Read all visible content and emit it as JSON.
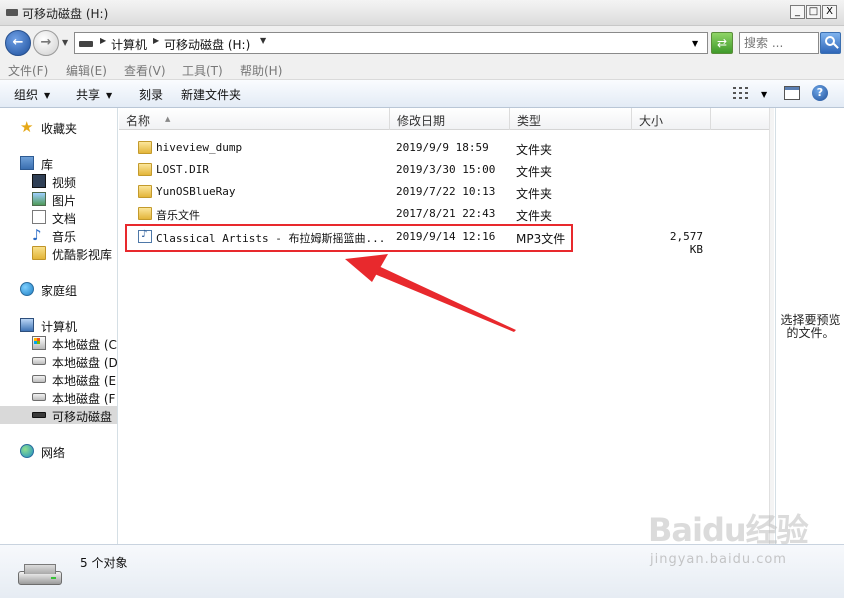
{
  "window": {
    "title": "可移动磁盘 (H:)",
    "minimize": "_",
    "maximize": "□",
    "close": "X"
  },
  "address": {
    "crumbs": [
      "计算机",
      "可移动磁盘 (H:)"
    ],
    "search_placeholder": "搜索 ..."
  },
  "menu": [
    "文件(F)",
    "编辑(E)",
    "查看(V)",
    "工具(T)",
    "帮助(H)"
  ],
  "commands": {
    "organize": "组织",
    "share": "共享",
    "burn": "刻录",
    "new_folder": "新建文件夹"
  },
  "nav": {
    "favorites": "收藏夹",
    "libraries": "库",
    "lib_items": [
      "视频",
      "图片",
      "文档",
      "音乐",
      "优酷影视库"
    ],
    "homegroup": "家庭组",
    "computer": "计算机",
    "drives": [
      "本地磁盘 (C",
      "本地磁盘 (D",
      "本地磁盘 (E",
      "本地磁盘 (F",
      "可移动磁盘"
    ],
    "network": "网络"
  },
  "columns": {
    "name": "名称",
    "date": "修改日期",
    "type": "类型",
    "size": "大小"
  },
  "files": [
    {
      "name": "hiveview_dump",
      "date": "2019/9/9 18:59",
      "type": "文件夹",
      "size": "",
      "icon": "folder-icon"
    },
    {
      "name": "LOST.DIR",
      "date": "2019/3/30 15:00",
      "type": "文件夹",
      "size": "",
      "icon": "folder-icon"
    },
    {
      "name": "YunOSBlueRay",
      "date": "2019/7/22 10:13",
      "type": "文件夹",
      "size": "",
      "icon": "folder-icon"
    },
    {
      "name": "音乐文件",
      "date": "2017/8/21 22:43",
      "type": "文件夹",
      "size": "",
      "icon": "folder-icon"
    },
    {
      "name": "Classical Artists - 布拉姆斯摇篮曲...",
      "date": "2019/9/14 12:16",
      "type": "MP3文件",
      "size": "2,577 KB",
      "icon": "mp3-file-icon"
    }
  ],
  "preview": {
    "text": "选择要预览的文件。"
  },
  "status": {
    "count": "5 个对象"
  },
  "watermark": {
    "brand": "Baidu经验",
    "url": "jingyan.baidu.com"
  },
  "colors": {
    "highlight": "#e8292d",
    "selected_nav": "#d9d9d9",
    "accent": "#1d4f9c"
  }
}
